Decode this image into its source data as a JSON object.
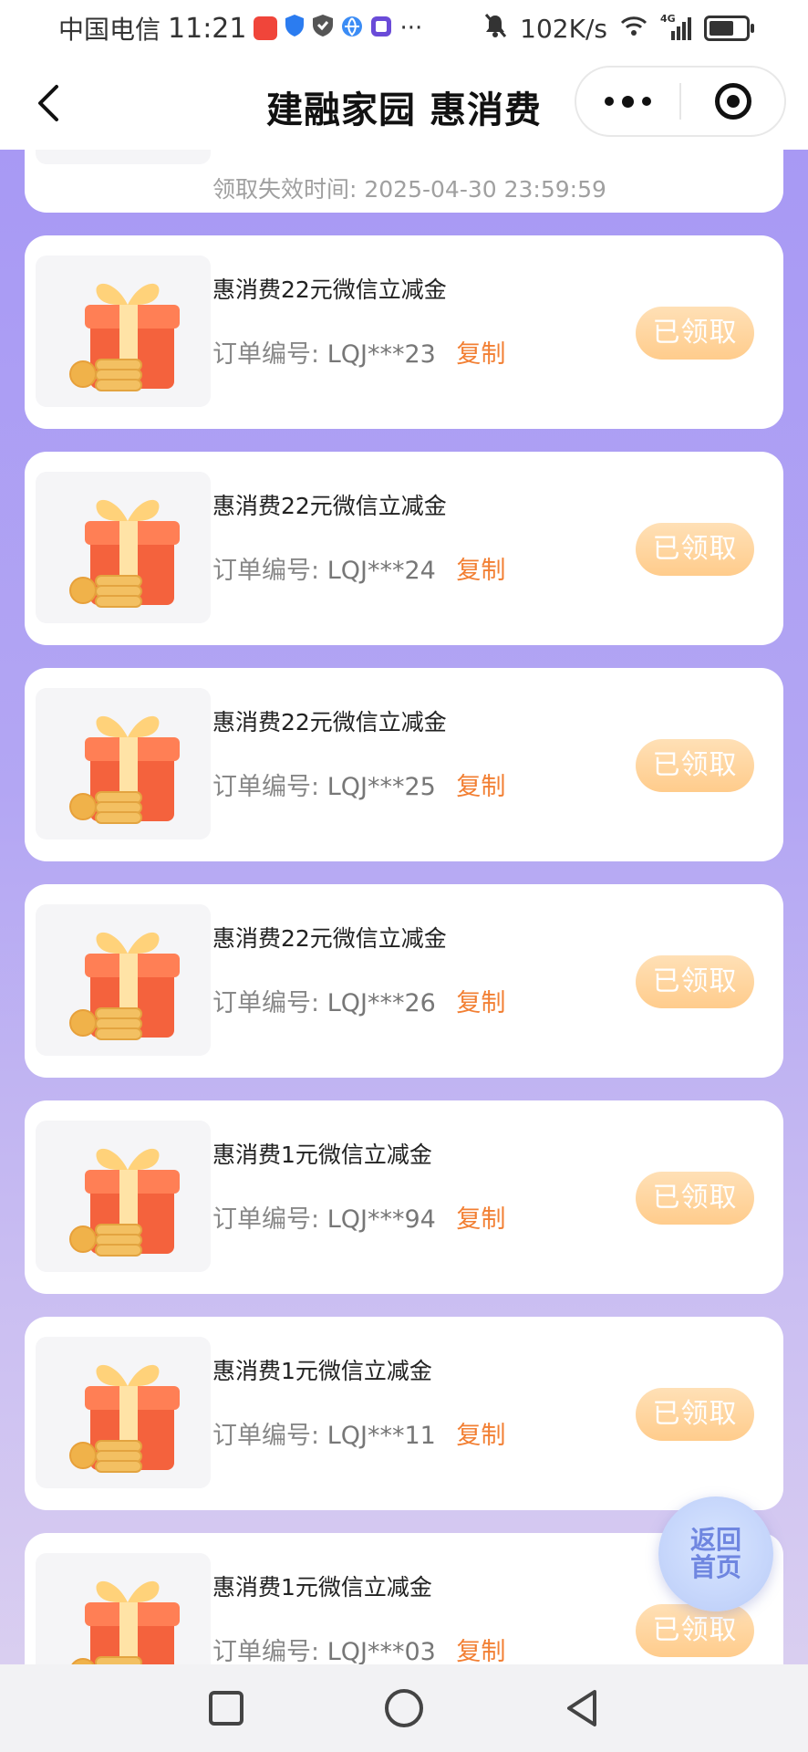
{
  "status_bar": {
    "carrier": "中国电信",
    "time": "11:21",
    "network_speed": "102K/s",
    "icons": [
      "app-icon",
      "shield-icon",
      "vpn-icon",
      "browser-icon",
      "sticker-icon",
      "more-dots-icon",
      "mute-bell-icon",
      "wifi-icon",
      "signal-4g-icon",
      "battery-icon"
    ],
    "more_glyph": "···",
    "net_label": "4G"
  },
  "navbar": {
    "title": "建融家园 惠消费"
  },
  "colors": {
    "accent": "#f27f33",
    "claimed_button": "#ffcc8c",
    "background_top": "#a596f4",
    "background_bottom": "#ddd2f0",
    "home_float_text": "#6f86e0"
  },
  "partial_card": {
    "expire_text": "领取失效时间: 2025-04-30 23:59:59"
  },
  "coupons": [
    {
      "title": "惠消费22元微信立减金",
      "order_label": "订单编号:",
      "order_no": "LQJ***23",
      "copy": "复制",
      "status": "已领取"
    },
    {
      "title": "惠消费22元微信立减金",
      "order_label": "订单编号:",
      "order_no": "LQJ***24",
      "copy": "复制",
      "status": "已领取"
    },
    {
      "title": "惠消费22元微信立减金",
      "order_label": "订单编号:",
      "order_no": "LQJ***25",
      "copy": "复制",
      "status": "已领取"
    },
    {
      "title": "惠消费22元微信立减金",
      "order_label": "订单编号:",
      "order_no": "LQJ***26",
      "copy": "复制",
      "status": "已领取"
    },
    {
      "title": "惠消费1元微信立减金",
      "order_label": "订单编号:",
      "order_no": "LQJ***94",
      "copy": "复制",
      "status": "已领取"
    },
    {
      "title": "惠消费1元微信立减金",
      "order_label": "订单编号:",
      "order_no": "LQJ***11",
      "copy": "复制",
      "status": "已领取"
    },
    {
      "title": "惠消费1元微信立减金",
      "order_label": "订单编号:",
      "order_no": "LQJ***03",
      "copy": "复制",
      "status": "已领取"
    }
  ],
  "home_button": {
    "line1": "返回",
    "line2": "首页"
  }
}
